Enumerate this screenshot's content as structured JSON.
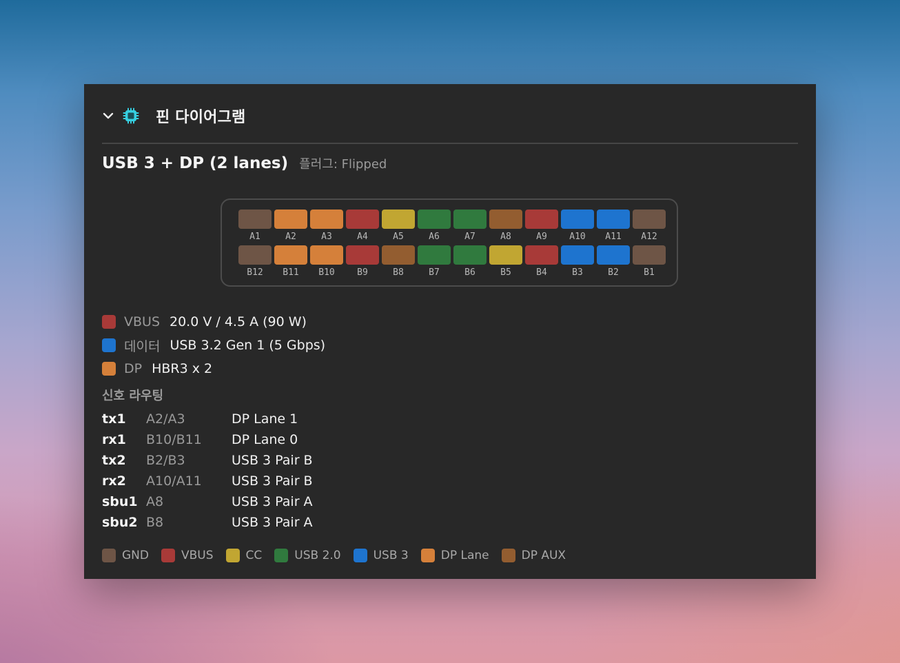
{
  "colors": {
    "gnd": "#6e5546",
    "vbus": "#a83a38",
    "cc": "#c1a632",
    "usb2": "#307a3e",
    "usb3": "#1e74cf",
    "dp_lane": "#d5803a",
    "dp_aux": "#935d30",
    "chip_icon": "#36cfe0"
  },
  "header": {
    "expand_icon": "chevron-down-icon",
    "chip_icon": "chip-icon",
    "title": "핀 다이어그램"
  },
  "subhead": {
    "mode": "USB 3 + DP (2 lanes)",
    "plug": "플러그: Flipped"
  },
  "pins": {
    "top": [
      {
        "label": "A1",
        "type": "gnd"
      },
      {
        "label": "A2",
        "type": "dp_lane"
      },
      {
        "label": "A3",
        "type": "dp_lane"
      },
      {
        "label": "A4",
        "type": "vbus"
      },
      {
        "label": "A5",
        "type": "cc"
      },
      {
        "label": "A6",
        "type": "usb2"
      },
      {
        "label": "A7",
        "type": "usb2"
      },
      {
        "label": "A8",
        "type": "dp_aux"
      },
      {
        "label": "A9",
        "type": "vbus"
      },
      {
        "label": "A10",
        "type": "usb3"
      },
      {
        "label": "A11",
        "type": "usb3"
      },
      {
        "label": "A12",
        "type": "gnd"
      }
    ],
    "bottom": [
      {
        "label": "B12",
        "type": "gnd"
      },
      {
        "label": "B11",
        "type": "dp_lane"
      },
      {
        "label": "B10",
        "type": "dp_lane"
      },
      {
        "label": "B9",
        "type": "vbus"
      },
      {
        "label": "B8",
        "type": "dp_aux"
      },
      {
        "label": "B7",
        "type": "usb2"
      },
      {
        "label": "B6",
        "type": "usb2"
      },
      {
        "label": "B5",
        "type": "cc"
      },
      {
        "label": "B4",
        "type": "vbus"
      },
      {
        "label": "B3",
        "type": "usb3"
      },
      {
        "label": "B2",
        "type": "usb3"
      },
      {
        "label": "B1",
        "type": "gnd"
      }
    ]
  },
  "specs": [
    {
      "key": "VBUS",
      "value": "20.0 V / 4.5 A (90 W)",
      "type": "vbus"
    },
    {
      "key": "데이터",
      "value": "USB 3.2 Gen 1 (5 Gbps)",
      "type": "usb3"
    },
    {
      "key": "DP",
      "value": "HBR3 x 2",
      "type": "dp_lane"
    }
  ],
  "routing": {
    "title": "신호 라우팅",
    "rows": [
      {
        "signal": "tx1",
        "pins": "A2/A3",
        "dest": "DP Lane 1"
      },
      {
        "signal": "rx1",
        "pins": "B10/B11",
        "dest": "DP Lane 0"
      },
      {
        "signal": "tx2",
        "pins": "B2/B3",
        "dest": "USB 3 Pair B"
      },
      {
        "signal": "rx2",
        "pins": "A10/A11",
        "dest": "USB 3 Pair B"
      },
      {
        "signal": "sbu1",
        "pins": "A8",
        "dest": "USB 3 Pair A"
      },
      {
        "signal": "sbu2",
        "pins": "B8",
        "dest": "USB 3 Pair A"
      }
    ]
  },
  "legend": [
    {
      "label": "GND",
      "type": "gnd"
    },
    {
      "label": "VBUS",
      "type": "vbus"
    },
    {
      "label": "CC",
      "type": "cc"
    },
    {
      "label": "USB 2.0",
      "type": "usb2"
    },
    {
      "label": "USB 3",
      "type": "usb3"
    },
    {
      "label": "DP Lane",
      "type": "dp_lane"
    },
    {
      "label": "DP AUX",
      "type": "dp_aux"
    }
  ]
}
